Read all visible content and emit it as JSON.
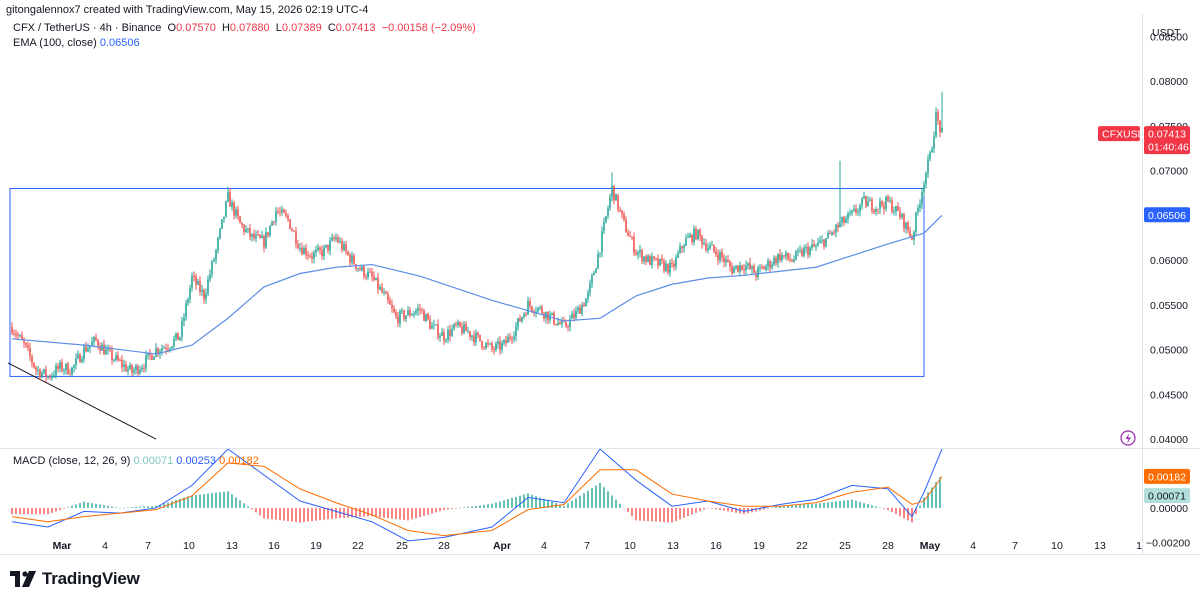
{
  "credit": "gitongalennox7 created with TradingView.com, May 15, 2026 02:19 UTC-4",
  "brand": {
    "name": "TradingView",
    "logo_icon": "tradingview-logo-icon"
  },
  "legend": {
    "symbol": "CFX / TetherUS · 4h · Binance",
    "o_label": "O",
    "o_value": "0.07570",
    "h_label": "H",
    "h_value": "0.07880",
    "l_label": "L",
    "l_value": "0.07389",
    "c_label": "C",
    "c_value": "0.07413",
    "change": "−0.00158 (−2.09%)",
    "ema_label": "EMA (100, close)",
    "ema_value": "0.06506"
  },
  "macd_legend": {
    "label": "MACD (close, 12, 26, 9)",
    "hist": "0.00071",
    "macd": "0.00253",
    "signal": "0.00182"
  },
  "price_axis": {
    "currency": "USDT",
    "ticks": [
      "0.08500",
      "0.08000",
      "0.07500",
      "0.07000",
      "0.06500",
      "0.06000",
      "0.05500",
      "0.05000",
      "0.04500",
      "0.04000"
    ]
  },
  "macd_axis": {
    "ticks": [
      "0.00000",
      "−0.00200"
    ]
  },
  "badges": {
    "symbol": "CFXUSDT",
    "price": "0.07413",
    "countdown": "01:40:46",
    "ema": "0.06506",
    "macd_signal": "0.00182",
    "macd_hist": "0.00071"
  },
  "time_axis": {
    "labels": [
      "Mar",
      "4",
      "7",
      "10",
      "13",
      "16",
      "19",
      "22",
      "25",
      "28",
      "Apr",
      "4",
      "7",
      "10",
      "13",
      "16",
      "19",
      "22",
      "25",
      "28",
      "May",
      "4",
      "7",
      "10",
      "13",
      "1"
    ]
  },
  "colors": {
    "up": "#26a69a",
    "down": "#ef5350",
    "ema": "#5b8ee6",
    "box": "#2962ff",
    "macd": "#2962ff",
    "signal": "#ff6d00",
    "hist_up": "#26a69a",
    "hist_down": "#ef5350",
    "price_badge": "#f23645"
  },
  "chart_data": {
    "type": "candlestick",
    "timeframe": "4h",
    "x_range": [
      "Feb 26",
      "May 14"
    ],
    "ylim": [
      0.039,
      0.0875
    ],
    "grid": false,
    "price_path": [
      {
        "x": "Feb 26",
        "y": 0.0525
      },
      {
        "x": "Feb 27",
        "y": 0.0505
      },
      {
        "x": "Feb 28",
        "y": 0.0478
      },
      {
        "x": "Mar 1",
        "y": 0.047
      },
      {
        "x": "Mar 2",
        "y": 0.048
      },
      {
        "x": "Mar 3",
        "y": 0.0478
      },
      {
        "x": "Mar 4",
        "y": 0.05
      },
      {
        "x": "Mar 5",
        "y": 0.051
      },
      {
        "x": "Mar 6",
        "y": 0.0495
      },
      {
        "x": "Mar 7",
        "y": 0.0485
      },
      {
        "x": "Mar 8",
        "y": 0.0475
      },
      {
        "x": "Mar 9",
        "y": 0.0485
      },
      {
        "x": "Mar 10",
        "y": 0.05
      },
      {
        "x": "Mar 11",
        "y": 0.0505
      },
      {
        "x": "Mar 12",
        "y": 0.0515
      },
      {
        "x": "Mar 13",
        "y": 0.058
      },
      {
        "x": "Mar 14",
        "y": 0.056
      },
      {
        "x": "Mar 15",
        "y": 0.061
      },
      {
        "x": "Mar 16",
        "y": 0.067
      },
      {
        "x": "Mar 17",
        "y": 0.064
      },
      {
        "x": "Mar 18",
        "y": 0.0625
      },
      {
        "x": "Mar 19",
        "y": 0.062
      },
      {
        "x": "Mar 20",
        "y": 0.0655
      },
      {
        "x": "Mar 21",
        "y": 0.0645
      },
      {
        "x": "Mar 22",
        "y": 0.0615
      },
      {
        "x": "Mar 23",
        "y": 0.0605
      },
      {
        "x": "Mar 24",
        "y": 0.061
      },
      {
        "x": "Mar 25",
        "y": 0.0625
      },
      {
        "x": "Mar 26",
        "y": 0.0605
      },
      {
        "x": "Mar 27",
        "y": 0.059
      },
      {
        "x": "Mar 28",
        "y": 0.058
      },
      {
        "x": "Mar 29",
        "y": 0.056
      },
      {
        "x": "Mar 30",
        "y": 0.0535
      },
      {
        "x": "Mar 31",
        "y": 0.054
      },
      {
        "x": "Apr 1",
        "y": 0.0545
      },
      {
        "x": "Apr 2",
        "y": 0.0525
      },
      {
        "x": "Apr 3",
        "y": 0.0515
      },
      {
        "x": "Apr 4",
        "y": 0.0525
      },
      {
        "x": "Apr 5",
        "y": 0.052
      },
      {
        "x": "Apr 6",
        "y": 0.051
      },
      {
        "x": "Apr 7",
        "y": 0.05
      },
      {
        "x": "Apr 8",
        "y": 0.0505
      },
      {
        "x": "Apr 9",
        "y": 0.0525
      },
      {
        "x": "Apr 10",
        "y": 0.055
      },
      {
        "x": "Apr 11",
        "y": 0.0545
      },
      {
        "x": "Apr 12",
        "y": 0.0535
      },
      {
        "x": "Apr 13",
        "y": 0.0525
      },
      {
        "x": "Apr 14",
        "y": 0.054
      },
      {
        "x": "Apr 15",
        "y": 0.056
      },
      {
        "x": "Apr 16",
        "y": 0.0615
      },
      {
        "x": "Apr 17",
        "y": 0.068
      },
      {
        "x": "Apr 18",
        "y": 0.064
      },
      {
        "x": "Apr 19",
        "y": 0.061
      },
      {
        "x": "Apr 20",
        "y": 0.06
      },
      {
        "x": "Apr 21",
        "y": 0.0595
      },
      {
        "x": "Apr 22",
        "y": 0.059
      },
      {
        "x": "Apr 23",
        "y": 0.062
      },
      {
        "x": "Apr 24",
        "y": 0.063
      },
      {
        "x": "Apr 25",
        "y": 0.0615
      },
      {
        "x": "Apr 26",
        "y": 0.0605
      },
      {
        "x": "Apr 27",
        "y": 0.059
      },
      {
        "x": "Apr 28",
        "y": 0.0595
      },
      {
        "x": "Apr 29",
        "y": 0.0585
      },
      {
        "x": "Apr 30",
        "y": 0.0595
      },
      {
        "x": "May 1",
        "y": 0.0605
      },
      {
        "x": "May 2",
        "y": 0.06
      },
      {
        "x": "May 3",
        "y": 0.061
      },
      {
        "x": "May 4",
        "y": 0.0615
      },
      {
        "x": "May 5",
        "y": 0.0625
      },
      {
        "x": "May 6",
        "y": 0.064
      },
      {
        "x": "May 7",
        "y": 0.065
      },
      {
        "x": "May 8",
        "y": 0.0665
      },
      {
        "x": "May 9",
        "y": 0.066
      },
      {
        "x": "May 10",
        "y": 0.0665
      },
      {
        "x": "May 11",
        "y": 0.065
      },
      {
        "x": "May 12",
        "y": 0.0625
      },
      {
        "x": "May 13",
        "y": 0.069
      },
      {
        "x": "May 13.5",
        "y": 0.0715
      },
      {
        "x": "May 14",
        "y": 0.076
      },
      {
        "x": "May 14.5",
        "y": 0.0741
      }
    ],
    "spike_highs": [
      {
        "x": "Mar 16",
        "y": 0.0682
      },
      {
        "x": "Apr 17",
        "y": 0.0698
      },
      {
        "x": "May 6",
        "y": 0.0711
      },
      {
        "x": "May 14.5",
        "y": 0.0788
      }
    ],
    "ema_path": [
      {
        "x": "Feb 26",
        "y": 0.0512
      },
      {
        "x": "Mar 4",
        "y": 0.0505
      },
      {
        "x": "Mar 10",
        "y": 0.0495
      },
      {
        "x": "Mar 13",
        "y": 0.0505
      },
      {
        "x": "Mar 16",
        "y": 0.0535
      },
      {
        "x": "Mar 19",
        "y": 0.057
      },
      {
        "x": "Mar 22",
        "y": 0.0585
      },
      {
        "x": "Mar 25",
        "y": 0.0592
      },
      {
        "x": "Mar 28",
        "y": 0.0595
      },
      {
        "x": "Apr 1",
        "y": 0.0582
      },
      {
        "x": "Apr 7",
        "y": 0.0555
      },
      {
        "x": "Apr 13",
        "y": 0.0532
      },
      {
        "x": "Apr 16",
        "y": 0.0535
      },
      {
        "x": "Apr 19",
        "y": 0.056
      },
      {
        "x": "Apr 22",
        "y": 0.0573
      },
      {
        "x": "Apr 25",
        "y": 0.058
      },
      {
        "x": "Apr 28",
        "y": 0.0583
      },
      {
        "x": "May 4",
        "y": 0.0592
      },
      {
        "x": "May 7",
        "y": 0.0605
      },
      {
        "x": "May 10",
        "y": 0.0618
      },
      {
        "x": "May 13",
        "y": 0.063
      },
      {
        "x": "May 14.5",
        "y": 0.065
      }
    ],
    "range_box": {
      "x_start": "Feb 26",
      "x_end": "May 13",
      "y_top": 0.068,
      "y_bottom": 0.047
    },
    "trendline": {
      "x_start": "Feb 26",
      "y_start": 0.0485,
      "x_end": "Mar 10",
      "y_end": 0.04
    },
    "macd": {
      "ylim": [
        -0.0026,
        0.0034
      ],
      "macd_path": [
        {
          "x": "Feb 26",
          "y": -0.0008
        },
        {
          "x": "Mar 1",
          "y": -0.0011
        },
        {
          "x": "Mar 4",
          "y": -0.0002
        },
        {
          "x": "Mar 7",
          "y": -0.0003
        },
        {
          "x": "Mar 10",
          "y": 0.0
        },
        {
          "x": "Mar 13",
          "y": 0.0013
        },
        {
          "x": "Mar 16",
          "y": 0.0034
        },
        {
          "x": "Mar 19",
          "y": 0.0019
        },
        {
          "x": "Mar 22",
          "y": 0.0004
        },
        {
          "x": "Mar 25",
          "y": -0.0002
        },
        {
          "x": "Mar 28",
          "y": -0.0008
        },
        {
          "x": "Mar 31",
          "y": -0.0019
        },
        {
          "x": "Apr 3",
          "y": -0.0017
        },
        {
          "x": "Apr 7",
          "y": -0.0011
        },
        {
          "x": "Apr 10",
          "y": 0.0006
        },
        {
          "x": "Apr 13",
          "y": 0.0003
        },
        {
          "x": "Apr 16",
          "y": 0.0034
        },
        {
          "x": "Apr 19",
          "y": 0.0016
        },
        {
          "x": "Apr 22",
          "y": 0.0001
        },
        {
          "x": "Apr 25",
          "y": 0.0004
        },
        {
          "x": "Apr 28",
          "y": -0.0002
        },
        {
          "x": "May 1",
          "y": 0.0002
        },
        {
          "x": "May 4",
          "y": 0.0005
        },
        {
          "x": "May 7",
          "y": 0.0013
        },
        {
          "x": "May 10",
          "y": 0.0011
        },
        {
          "x": "May 12",
          "y": -0.0005
        },
        {
          "x": "May 13",
          "y": 0.0009
        },
        {
          "x": "May 14.5",
          "y": 0.0034
        }
      ],
      "signal_path": [
        {
          "x": "Feb 26",
          "y": -0.0005
        },
        {
          "x": "Mar 1",
          "y": -0.0008
        },
        {
          "x": "Mar 4",
          "y": -0.0005
        },
        {
          "x": "Mar 7",
          "y": -0.0003
        },
        {
          "x": "Mar 10",
          "y": -0.0001
        },
        {
          "x": "Mar 13",
          "y": 0.0007
        },
        {
          "x": "Mar 16",
          "y": 0.0026
        },
        {
          "x": "Mar 19",
          "y": 0.0024
        },
        {
          "x": "Mar 22",
          "y": 0.0011
        },
        {
          "x": "Mar 25",
          "y": 0.0003
        },
        {
          "x": "Mar 28",
          "y": -0.0004
        },
        {
          "x": "Mar 31",
          "y": -0.0013
        },
        {
          "x": "Apr 3",
          "y": -0.0016
        },
        {
          "x": "Apr 7",
          "y": -0.0013
        },
        {
          "x": "Apr 10",
          "y": -0.0001
        },
        {
          "x": "Apr 13",
          "y": 0.0002
        },
        {
          "x": "Apr 16",
          "y": 0.0022
        },
        {
          "x": "Apr 19",
          "y": 0.0022
        },
        {
          "x": "Apr 22",
          "y": 0.0008
        },
        {
          "x": "Apr 25",
          "y": 0.0004
        },
        {
          "x": "Apr 28",
          "y": 0.0001
        },
        {
          "x": "May 1",
          "y": 0.0001
        },
        {
          "x": "May 4",
          "y": 0.0003
        },
        {
          "x": "May 7",
          "y": 0.0009
        },
        {
          "x": "May 10",
          "y": 0.0012
        },
        {
          "x": "May 12",
          "y": 0.0002
        },
        {
          "x": "May 13",
          "y": 0.0004
        },
        {
          "x": "May 14.5",
          "y": 0.0018
        }
      ]
    }
  }
}
